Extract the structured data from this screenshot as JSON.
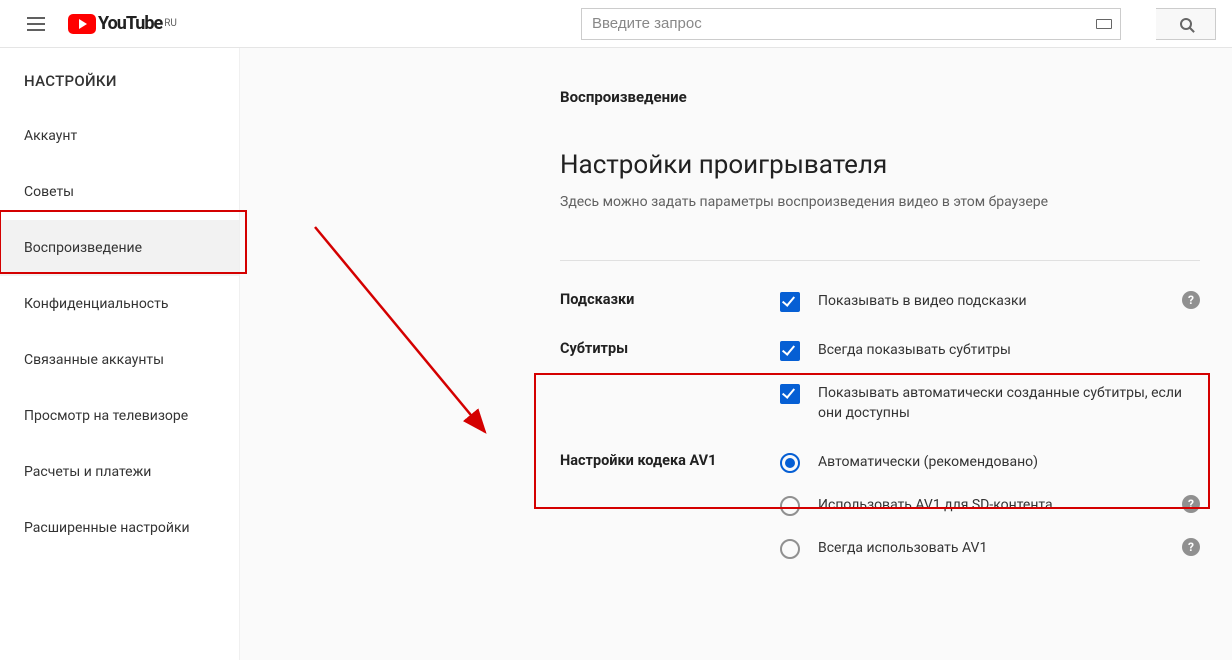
{
  "header": {
    "logo_text": "YouTube",
    "logo_locale": "RU",
    "search_placeholder": "Введите запрос"
  },
  "sidebar": {
    "title": "НАСТРОЙКИ",
    "items": [
      {
        "label": "Аккаунт"
      },
      {
        "label": "Советы"
      },
      {
        "label": "Воспроизведение",
        "active": true
      },
      {
        "label": "Конфиденциальность"
      },
      {
        "label": "Связанные аккаунты"
      },
      {
        "label": "Просмотр на телевизоре"
      },
      {
        "label": "Расчеты и платежи"
      },
      {
        "label": "Расширенные настройки"
      }
    ]
  },
  "content": {
    "section": "Воспроизведение",
    "title": "Настройки проигрывателя",
    "description": "Здесь можно задать параметры воспроизведения видео в этом браузере",
    "hints": {
      "label": "Подсказки",
      "option1": "Показывать в видео подсказки"
    },
    "subtitles": {
      "label": "Субтитры",
      "option1": "Всегда показывать субтитры",
      "option2": "Показывать автоматически созданные субтитры, если они доступны"
    },
    "av1": {
      "label": "Настройки кодека AV1",
      "option1": "Автоматически (рекомендовано)",
      "option2": "Использовать AV1 для SD-контента",
      "option3": "Всегда использовать AV1"
    }
  }
}
